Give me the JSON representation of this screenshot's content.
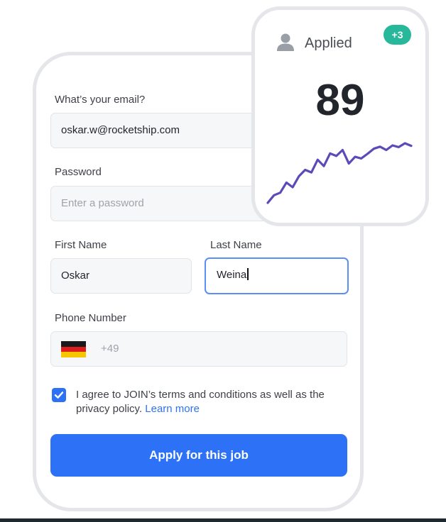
{
  "form": {
    "email": {
      "label": "What’s your email?",
      "value": "oskar.w@rocketship.com"
    },
    "password": {
      "label": "Password",
      "placeholder": "Enter a password"
    },
    "first_name": {
      "label": "First Name",
      "value": "Oskar"
    },
    "last_name": {
      "label": "Last Name",
      "value": "Weina"
    },
    "phone": {
      "label": "Phone Number",
      "prefix": "+49",
      "country_flag": "germany-flag"
    },
    "consent": {
      "checked": true,
      "text": "I agree to JOIN’s terms and conditions as well as the privacy policy.",
      "link": "Learn more"
    },
    "submit_label": "Apply for this job"
  },
  "stats": {
    "icon": "user-icon",
    "title": "Applied",
    "badge": "+3",
    "value": "89",
    "sparkline": [
      10,
      28,
      34,
      58,
      47,
      73,
      88,
      82,
      112,
      97,
      127,
      121,
      135,
      103,
      119,
      115,
      126,
      138,
      143,
      135,
      146,
      142,
      151,
      145
    ],
    "line_color": "#5b4ab8"
  },
  "colors": {
    "primary": "#2d72f6",
    "badge": "#27b79b",
    "focus_border": "#5b8ff7"
  }
}
